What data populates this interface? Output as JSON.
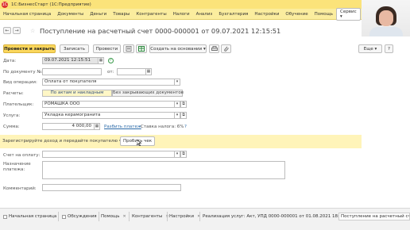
{
  "app": {
    "title": "1С:БизнесСтарт  (1С:Предприятие)",
    "logo": "1С"
  },
  "menu": [
    "Начальная страница",
    "Документы",
    "Деньги",
    "Товары",
    "Контрагенты",
    "Налоги",
    "Анализ",
    "Бухгалтерия",
    "Настройки",
    "Обучение",
    "Помощь"
  ],
  "service_label": "Сервис",
  "nav": {
    "back_icon": "arrow-left-icon",
    "forward_icon": "arrow-right-icon",
    "favorite_icon": "star-icon"
  },
  "document": {
    "title": "Поступление на расчетный счет 0000-000001 от 09.07.2021 12:15:51"
  },
  "toolbar": {
    "post_and_close": "Провести и закрыть",
    "save": "Записать",
    "post": "Провести",
    "create_based_on": "Создать на основании",
    "more": "Еще"
  },
  "form": {
    "date_label": "Дата:",
    "date_value": "09.07.2021 12:15:51",
    "doc_number_label": "По документу №:",
    "doc_number_value": "",
    "from_label": "от:",
    "from_value": "",
    "operation_label": "Вид операции:",
    "operation_value": "Оплата от покупателя",
    "settlements_label": "Расчеты:",
    "settlements_tab1": "По актам и накладным",
    "settlements_tab2": "Без закрывающих документов",
    "payer_label": "Плательщик:",
    "payer_value": "РОМАШКА ООО",
    "service_label": "Услуга:",
    "service_value": "Укладка керамогранита",
    "sum_label": "Сумма:",
    "sum_value": "4 000,00",
    "split_payment": "Разбить платеж",
    "vat_rate": "Ставка налога: 6%",
    "help_mark": "?",
    "invoice_label": "Счет на оплату:",
    "invoice_value": "",
    "purpose_label": "Назначение платежа:",
    "purpose_value": "",
    "comment_label": "Комментарий:",
    "comment_value": ""
  },
  "banner": {
    "text": "Зарегистрируйте доход и передайте покупателю чек",
    "button": "Пробить чек"
  },
  "taskbar": [
    "Начальная страница",
    "Обсуждения",
    "Помощь",
    "Контрагенты",
    "Настройки",
    "Реализация услуг: Акт, УПД 0000-000001 от 01.08.2021 18:21:20",
    "Поступление на расчетный сч..."
  ]
}
